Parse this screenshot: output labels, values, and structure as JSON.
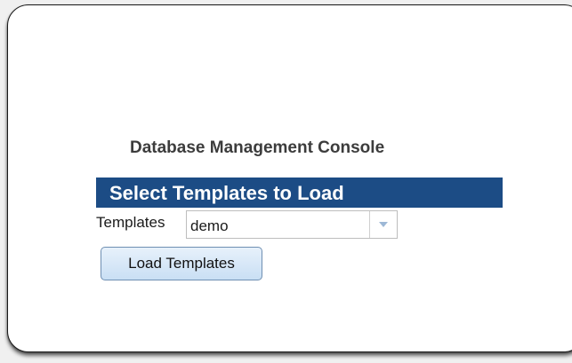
{
  "console": {
    "title": "Database Management Console"
  },
  "section": {
    "header": "Select Templates to Load"
  },
  "templates": {
    "label": "Templates",
    "selected": "demo",
    "arrow_icon": "chevron-down-icon"
  },
  "actions": {
    "load_label": "Load Templates"
  },
  "colors": {
    "header_background": "#1c4c85",
    "button_background": "#d6e7f8"
  }
}
